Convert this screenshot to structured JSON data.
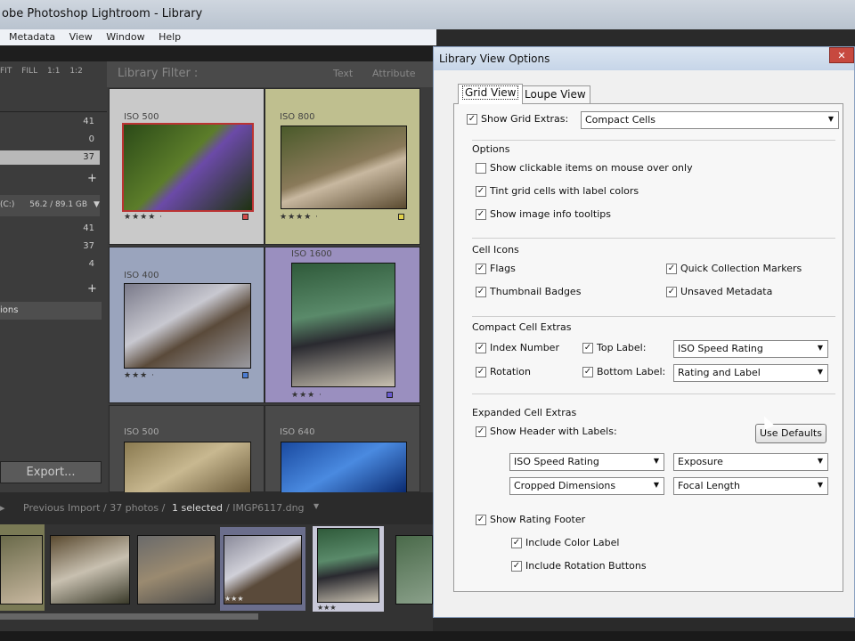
{
  "window": {
    "title": "obe Photoshop Lightroom - Library"
  },
  "menu": {
    "items": [
      "Metadata",
      "View",
      "Window",
      "Help"
    ]
  },
  "leftpanel": {
    "zoom_options": [
      "FIT",
      "FILL",
      "1:1",
      "1:2"
    ],
    "counts_top": [
      "41",
      "0",
      "37"
    ],
    "disk": "(C:)",
    "disk_space": "56.2 / 89.1 GB",
    "counts_mid": [
      "41",
      "37",
      "4"
    ],
    "collection_label": "ions",
    "export_label": "Export..."
  },
  "grid": {
    "filter_title": "Library Filter :",
    "filter_text": "Text",
    "filter_attribute": "Attribute",
    "cells": [
      {
        "iso": "ISO 500",
        "stars": "★★★★ ·",
        "label_color": "#d24a4a"
      },
      {
        "iso": "ISO 800",
        "stars": "★★★★ ·",
        "label_color": "#e2d24a"
      },
      {
        "iso": "ISO 400",
        "stars": "★★★ ·",
        "label_color": "#4a7bd2"
      },
      {
        "iso": "ISO 1600",
        "stars": "★★★ ·",
        "label_color": "#6a5ad2"
      },
      {
        "iso": "ISO 500",
        "stars": "",
        "label_color": ""
      },
      {
        "iso": "ISO 640",
        "stars": "",
        "label_color": ""
      }
    ]
  },
  "bottombar": {
    "source": "Previous Import / 37 photos /",
    "selected": "1 selected",
    "filename": "/ IMGP6117.dng"
  },
  "filmstrip": {
    "stars_a": "★★★",
    "stars_b": "★★★"
  },
  "dialog": {
    "title": "Library View Options",
    "close": "✕",
    "tabs": [
      "Grid View",
      "Loupe View"
    ],
    "show_grid_extras": {
      "label": "Show Grid Extras:",
      "checked": true,
      "value": "Compact Cells"
    },
    "options": {
      "heading": "Options",
      "items": [
        {
          "label": "Show clickable items on mouse over only",
          "checked": false
        },
        {
          "label": "Tint grid cells with label colors",
          "checked": true
        },
        {
          "label": "Show image info tooltips",
          "checked": true
        }
      ]
    },
    "cell_icons": {
      "heading": "Cell Icons",
      "flags": "Flags",
      "thumbnail_badges": "Thumbnail Badges",
      "quick_collection": "Quick Collection Markers",
      "unsaved_metadata": "Unsaved Metadata"
    },
    "compact": {
      "heading": "Compact Cell Extras",
      "index_number": "Index Number",
      "rotation": "Rotation",
      "top_label": "Top Label:",
      "bottom_label": "Bottom Label:",
      "top_value": "ISO Speed Rating",
      "bottom_value": "Rating and Label"
    },
    "expanded": {
      "heading": "Expanded Cell Extras",
      "show_header": "Show Header with Labels:",
      "use_defaults": "Use Defaults",
      "sel1": "ISO Speed Rating",
      "sel2": "Exposure",
      "sel3": "Cropped Dimensions",
      "sel4": "Focal Length",
      "rating_footer": "Show Rating Footer",
      "color_label": "Include Color Label",
      "rotation_buttons": "Include Rotation Buttons"
    }
  },
  "colors": {
    "dialog_bg": "#f0f0f0",
    "close_red": "#c7493f",
    "lightroom_dark": "#3b3b3b"
  }
}
